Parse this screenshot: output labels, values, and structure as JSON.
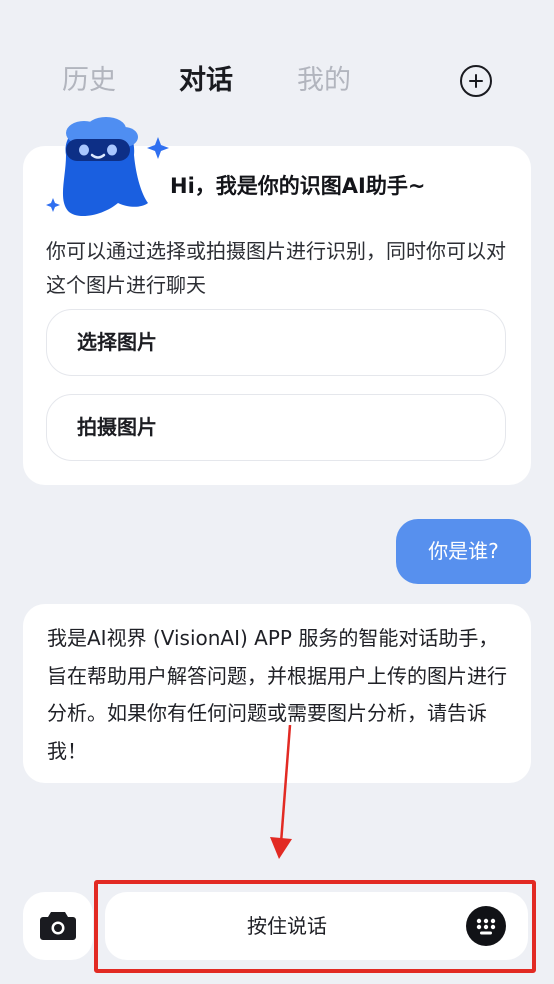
{
  "tabs": {
    "history": "历史",
    "chat": "对话",
    "mine": "我的",
    "active": "chat"
  },
  "welcome": {
    "title": "Hi，我是你的识图AI助手~",
    "description": "你可以通过选择或拍摄图片进行识别，同时你可以对这个图片进行聊天",
    "buttons": {
      "select": "选择图片",
      "shoot": "拍摄图片"
    }
  },
  "messages": {
    "user": "你是谁?",
    "assistant": "我是AI视界 (VisionAI) APP 服务的智能对话助手，旨在帮助用户解答问题，并根据用户上传的图片进行分析。如果你有任何问题或需要图片分析，请告诉我！"
  },
  "input_bar": {
    "voice_label": "按住说话"
  },
  "icons": {
    "new_chat": "plus-circle-icon",
    "camera": "camera-icon",
    "keyboard": "keyboard-icon",
    "mascot": "ghost-mascot-icon"
  },
  "colors": {
    "background": "#eef0f5",
    "user_bubble": "#5790ee",
    "mascot_blue": "#1a5fe0",
    "annotation": "#e22a23"
  }
}
